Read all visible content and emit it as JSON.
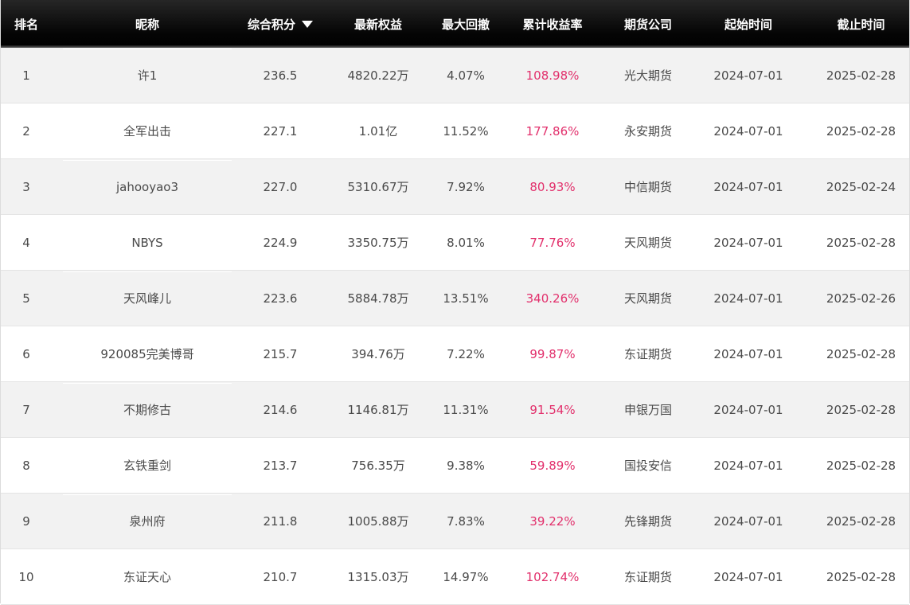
{
  "table": {
    "headers": {
      "rank": "排名",
      "nickname": "昵称",
      "score": "综合积分",
      "equity": "最新权益",
      "drawdown": "最大回撤",
      "cumulative_return": "累计收益率",
      "broker": "期货公司",
      "start_date": "起始时间",
      "end_date": "截止时间"
    },
    "sort": {
      "column": "综合积分",
      "direction": "descending",
      "icon": "sort-desc-triangle-icon"
    },
    "colors": {
      "header_bg": "#000000",
      "header_text": "#ffffff",
      "row_alt_bg": "#f2f2f2",
      "row_bg": "#ffffff",
      "body_text": "#4a4a4a",
      "return_text": "#e2306c"
    },
    "rows": [
      {
        "rank": "1",
        "nickname": "许1",
        "score": "236.5",
        "equity": "4820.22万",
        "drawdown": "4.07%",
        "cumulative_return": "108.98%",
        "broker": "光大期货",
        "start_date": "2024-07-01",
        "end_date": "2025-02-28"
      },
      {
        "rank": "2",
        "nickname": "全军出击",
        "score": "227.1",
        "equity": "1.01亿",
        "drawdown": "11.52%",
        "cumulative_return": "177.86%",
        "broker": "永安期货",
        "start_date": "2024-07-01",
        "end_date": "2025-02-28"
      },
      {
        "rank": "3",
        "nickname": "jahooyao3",
        "score": "227.0",
        "equity": "5310.67万",
        "drawdown": "7.92%",
        "cumulative_return": "80.93%",
        "broker": "中信期货",
        "start_date": "2024-07-01",
        "end_date": "2025-02-24"
      },
      {
        "rank": "4",
        "nickname": "NBYS",
        "score": "224.9",
        "equity": "3350.75万",
        "drawdown": "8.01%",
        "cumulative_return": "77.76%",
        "broker": "天风期货",
        "start_date": "2024-07-01",
        "end_date": "2025-02-28"
      },
      {
        "rank": "5",
        "nickname": "天风峰儿",
        "score": "223.6",
        "equity": "5884.78万",
        "drawdown": "13.51%",
        "cumulative_return": "340.26%",
        "broker": "天风期货",
        "start_date": "2024-07-01",
        "end_date": "2025-02-26"
      },
      {
        "rank": "6",
        "nickname": "920085完美博哥",
        "score": "215.7",
        "equity": "394.76万",
        "drawdown": "7.22%",
        "cumulative_return": "99.87%",
        "broker": "东证期货",
        "start_date": "2024-07-01",
        "end_date": "2025-02-28"
      },
      {
        "rank": "7",
        "nickname": "不期修古",
        "score": "214.6",
        "equity": "1146.81万",
        "drawdown": "11.31%",
        "cumulative_return": "91.54%",
        "broker": "申银万国",
        "start_date": "2024-07-01",
        "end_date": "2025-02-28"
      },
      {
        "rank": "8",
        "nickname": "玄铁重剑",
        "score": "213.7",
        "equity": "756.35万",
        "drawdown": "9.38%",
        "cumulative_return": "59.89%",
        "broker": "国投安信",
        "start_date": "2024-07-01",
        "end_date": "2025-02-28"
      },
      {
        "rank": "9",
        "nickname": "泉州府",
        "score": "211.8",
        "equity": "1005.88万",
        "drawdown": "7.83%",
        "cumulative_return": "39.22%",
        "broker": "先锋期货",
        "start_date": "2024-07-01",
        "end_date": "2025-02-28"
      },
      {
        "rank": "10",
        "nickname": "东证天心",
        "score": "210.7",
        "equity": "1315.03万",
        "drawdown": "14.97%",
        "cumulative_return": "102.74%",
        "broker": "东证期货",
        "start_date": "2024-07-01",
        "end_date": "2025-02-28"
      }
    ]
  }
}
